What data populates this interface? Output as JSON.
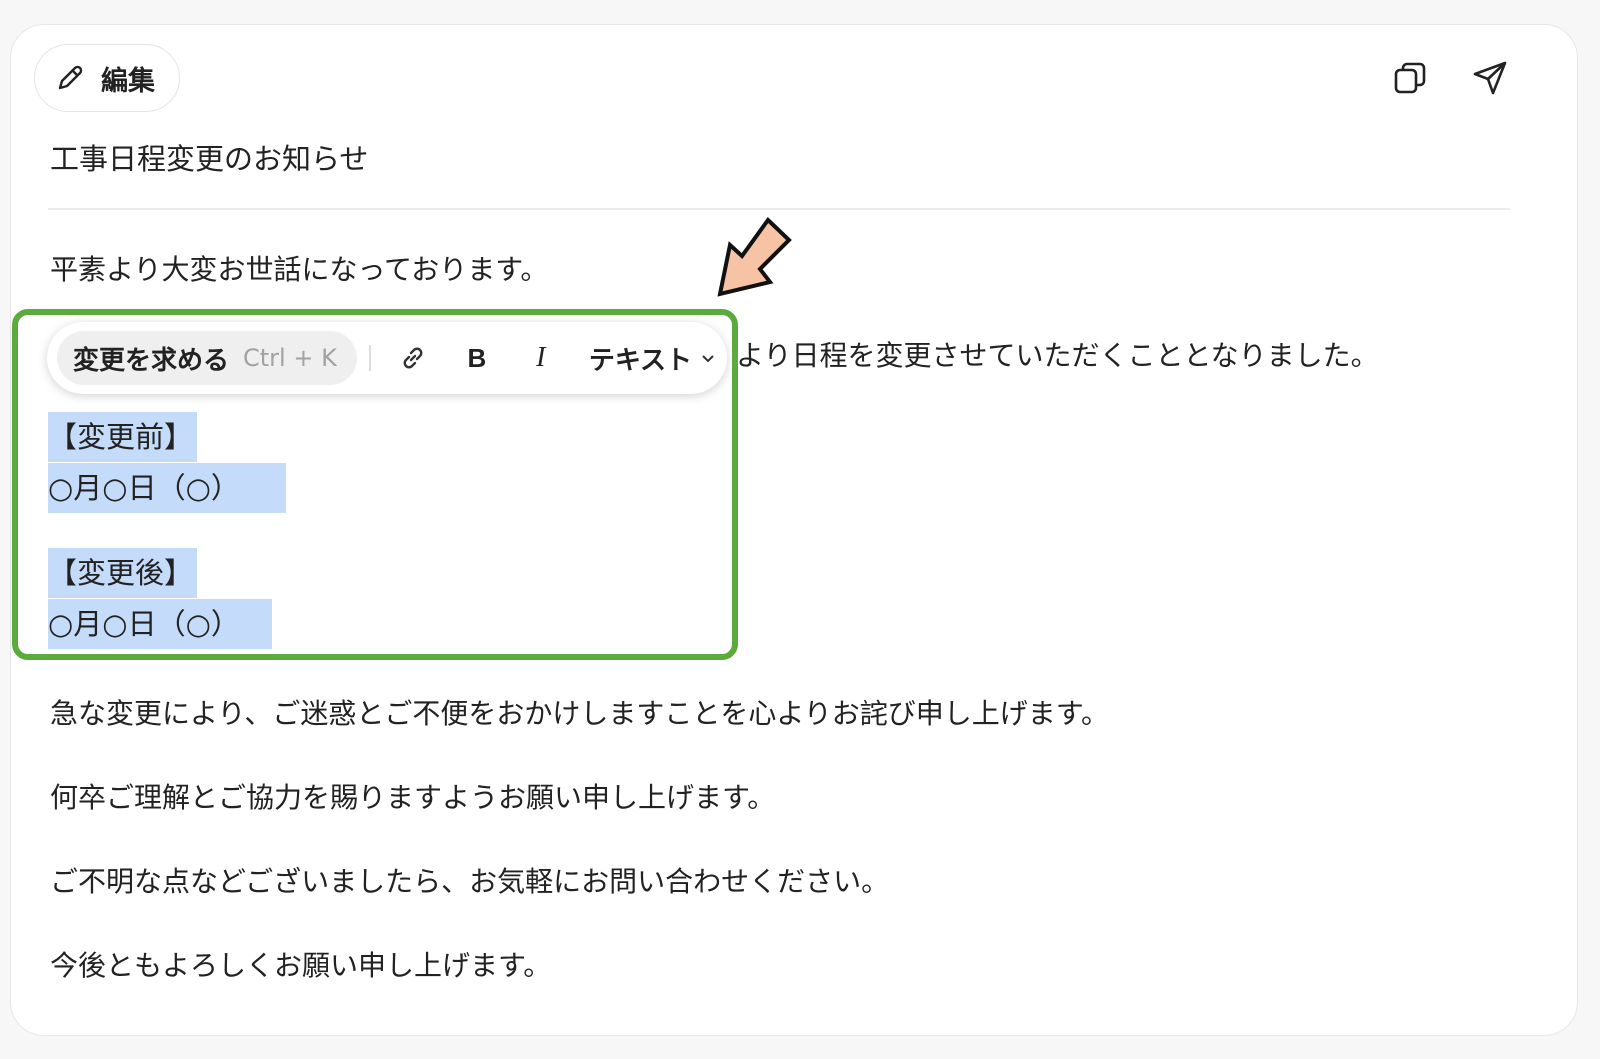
{
  "header": {
    "edit_label": "編集",
    "actions": {
      "copy_icon": "copy-icon",
      "send_icon": "send-icon"
    }
  },
  "document": {
    "title": "工事日程変更のお知らせ",
    "greeting": "平素より大変お世話になっております。",
    "line_partial": "より日程を変更させていただくこととなりました。",
    "before_heading": "【変更前】",
    "before_date": "○月○日（○）",
    "after_heading": "【変更後】",
    "after_date": "○月○日（○）",
    "apology": "急な変更により、ご迷惑とご不便をおかけしますことを心よりお詫び申し上げます。",
    "request": "何卒ご理解とご協力を賜りますようお願い申し上げます。",
    "contact": "ご不明な点などございましたら、お気軽にお問い合わせください。",
    "closing": "今後ともよろしくお願い申し上げます。"
  },
  "toolbar": {
    "ask_label": "変更を求める",
    "ask_shortcut": "Ctrl + K",
    "bold_label": "B",
    "italic_label": "I",
    "text_style_label": "テキスト"
  },
  "colors": {
    "selection": "#c4dcfa",
    "highlight_border": "#5aaa3c",
    "arrow_fill": "#f6c4a4"
  }
}
